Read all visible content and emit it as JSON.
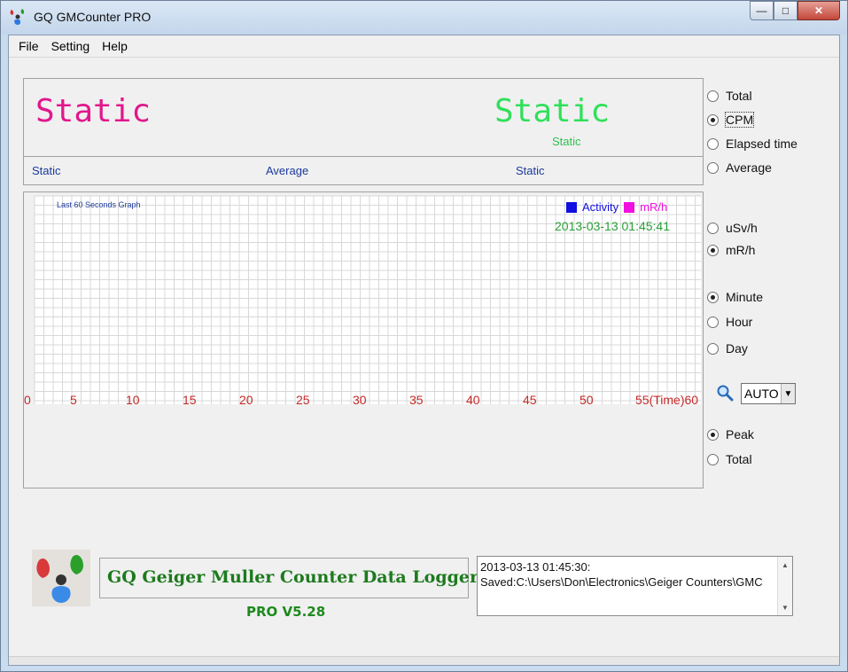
{
  "window": {
    "title": "GQ GMCounter PRO",
    "controls": {
      "minimize": "0",
      "maximize": "□",
      "close": "✕"
    }
  },
  "menu": {
    "items": [
      "File",
      "Setting",
      "Help"
    ]
  },
  "top_panel": {
    "big_left": "Static",
    "big_right": "Static",
    "small_right": "Static",
    "labels": [
      "Static",
      "Average",
      "Static"
    ]
  },
  "graph": {
    "title": "Last 60 Seconds Graph",
    "legend": [
      {
        "label": "Activity",
        "color": "#1010e0"
      },
      {
        "label": "mR/h",
        "color": "#f010e0"
      }
    ],
    "timestamp": "2013-03-13  01:45:41",
    "x_ticks": [
      "0",
      "5",
      "10",
      "15",
      "20",
      "25",
      "30",
      "35",
      "40",
      "45",
      "50",
      "55(Time)60"
    ]
  },
  "controls": {
    "display_mode": [
      {
        "label": "Total",
        "checked": false
      },
      {
        "label": "CPM",
        "checked": true
      },
      {
        "label": "Elapsed time",
        "checked": false
      },
      {
        "label": "Average",
        "checked": false
      }
    ],
    "unit": [
      {
        "label": "uSv/h",
        "checked": false
      },
      {
        "label": "mR/h",
        "checked": true
      }
    ],
    "period": [
      {
        "label": "Minute",
        "checked": true
      },
      {
        "label": "Hour",
        "checked": false
      },
      {
        "label": "Day",
        "checked": false
      }
    ],
    "zoom_icon": "magnifier-icon",
    "scale_select": {
      "value": "AUTO"
    },
    "peak_total": [
      {
        "label": "Peak",
        "checked": true
      },
      {
        "label": "Total",
        "checked": false
      }
    ]
  },
  "footer": {
    "brand_title": "GQ Geiger Muller Counter Data Logger",
    "version": "PRO V5.28",
    "log_lines": [
      "2013-03-13 01:45:30:",
      "Saved:C:\\Users\\Don\\Electronics\\Geiger Counters\\GMC"
    ]
  }
}
